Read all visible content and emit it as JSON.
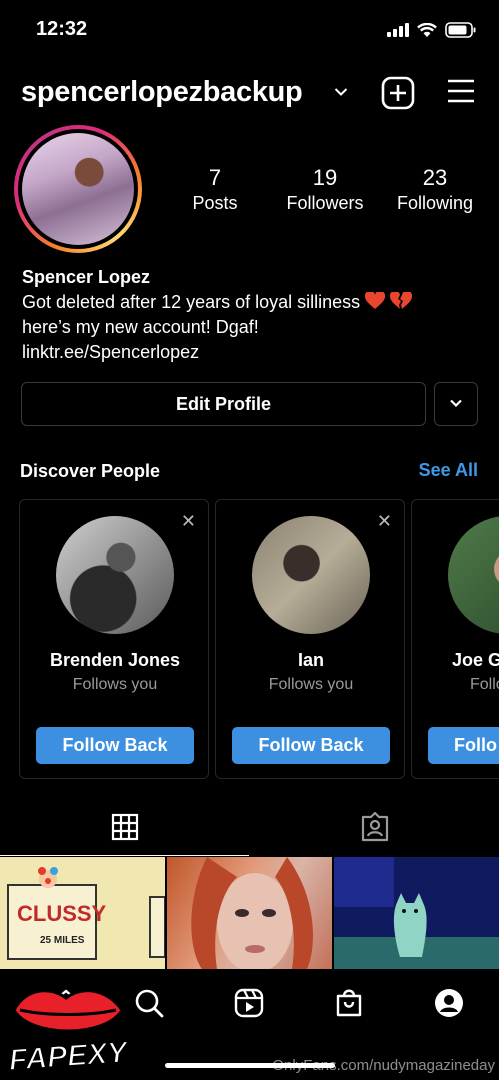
{
  "status": {
    "time": "12:32"
  },
  "header": {
    "username": "spencerlopezbackup"
  },
  "stats": [
    {
      "value": "7",
      "label": "Posts"
    },
    {
      "value": "19",
      "label": "Followers"
    },
    {
      "value": "23",
      "label": "Following"
    }
  ],
  "bio": {
    "name": "Spencer Lopez",
    "line1": "Got deleted after 12 years of loyal silliness",
    "line2": "here’s my new account! Dgaf!",
    "link": "linktr.ee/Spencerlopez"
  },
  "buttons": {
    "edit_profile": "Edit Profile"
  },
  "discover": {
    "title": "Discover People",
    "see_all": "See All",
    "cards": [
      {
        "name": "Brenden Jones",
        "subtitle": "Follows you",
        "button": "Follow Back"
      },
      {
        "name": "Ian",
        "subtitle": "Follows you",
        "button": "Follow Back"
      },
      {
        "name": "Joe G",
        "subtitle": "Follo",
        "button": "Follo"
      }
    ]
  },
  "grid": {
    "post1_text": "CLUSSY",
    "post1_sub": "25 MILES"
  },
  "branding": {
    "logo_text": "FAPEXY",
    "watermark": "OnlyFans.com/nudymagazineday"
  },
  "colors": {
    "accent": "#3d9ae8",
    "button": "#3d8fe0",
    "background": "#000000"
  },
  "icons": [
    "add-icon",
    "menu-icon",
    "chevron-down-icon",
    "grid-icon",
    "tagged-icon",
    "home-icon",
    "search-icon",
    "reels-icon",
    "shop-icon",
    "profile-icon",
    "close-icon"
  ]
}
